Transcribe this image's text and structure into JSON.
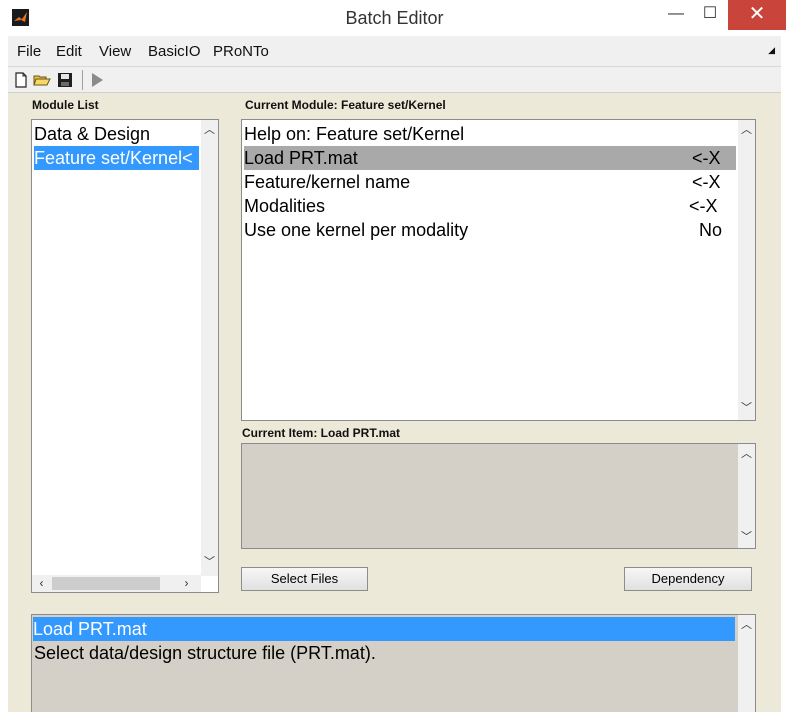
{
  "window": {
    "title": "Batch Editor",
    "minimize_glyph": "—",
    "maximize_glyph": "☐",
    "close_glyph": "✕"
  },
  "menu": {
    "items": [
      "File",
      "Edit",
      "View",
      "BasicIO",
      "PRoNTo"
    ],
    "overflow_glyph": "◢"
  },
  "module_list": {
    "label": "Module List",
    "items": [
      "Data & Design",
      "Feature set/Kernel<"
    ],
    "selected_index": 1
  },
  "current_module": {
    "label": "Current Module: Feature set/Kernel",
    "rows": [
      {
        "name": "Help on: Feature set/Kernel",
        "value": ""
      },
      {
        "name": "Load PRT.mat",
        "value": "<-X"
      },
      {
        "name": "Feature/kernel name",
        "value": "<-X"
      },
      {
        "name": "Modalities",
        "value": "<-X"
      },
      {
        "name": "Use one kernel per modality",
        "value": "No"
      }
    ],
    "selected_index": 1
  },
  "current_item": {
    "label": "Current Item: Load PRT.mat"
  },
  "buttons": {
    "select_files": "Select Files",
    "dependency": "Dependency"
  },
  "help_panel": {
    "title": "Load PRT.mat",
    "description": "Select data/design structure file (PRT.mat)."
  },
  "colors": {
    "selection_blue": "#3399ff",
    "selection_gray": "#a9a9a9",
    "panel_background": "#ece9d8",
    "close_button": "#c9443a"
  },
  "icons": [
    "matlab-logo-icon",
    "new-file-icon",
    "open-folder-icon",
    "save-icon",
    "run-icon"
  ]
}
